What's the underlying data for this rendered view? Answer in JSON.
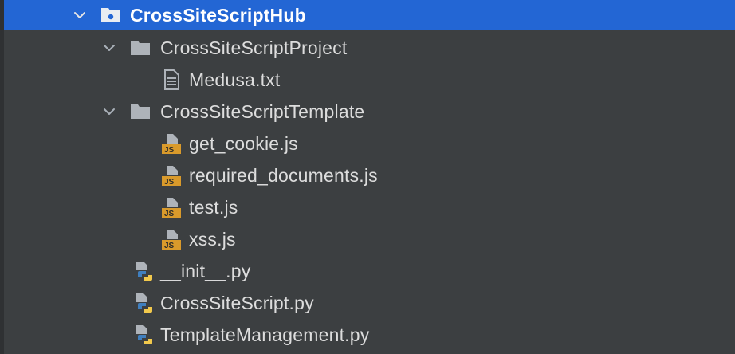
{
  "colors": {
    "background": "#3c3f41",
    "selection": "#2366d4",
    "folder": "#aeb3b9",
    "js_badge": "#d99a2b",
    "python_blue": "#3f7fbf",
    "python_yellow": "#f2c94c"
  },
  "tree": {
    "root": {
      "label": "CrossSiteScriptHub",
      "icon": "module-folder-icon",
      "expanded": true
    },
    "project_folder": {
      "label": "CrossSiteScriptProject",
      "icon": "folder-icon",
      "expanded": true
    },
    "project_files": [
      {
        "label": "Medusa.txt",
        "icon": "text-file-icon"
      }
    ],
    "template_folder": {
      "label": "CrossSiteScriptTemplate",
      "icon": "folder-icon",
      "expanded": true
    },
    "template_files": [
      {
        "label": "get_cookie.js",
        "icon": "javascript-file-icon"
      },
      {
        "label": "required_documents.js",
        "icon": "javascript-file-icon"
      },
      {
        "label": "test.js",
        "icon": "javascript-file-icon"
      },
      {
        "label": "xss.js",
        "icon": "javascript-file-icon"
      }
    ],
    "python_files": [
      {
        "label": "__init__.py",
        "icon": "python-file-icon"
      },
      {
        "label": "CrossSiteScript.py",
        "icon": "python-file-icon"
      },
      {
        "label": "TemplateManagement.py",
        "icon": "python-file-icon"
      }
    ],
    "js_badge_text": "JS"
  }
}
